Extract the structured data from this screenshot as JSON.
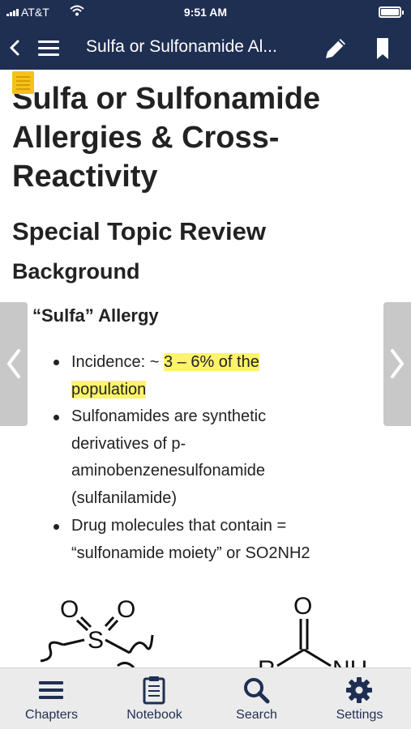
{
  "status_bar": {
    "carrier": "AT&T",
    "time": "9:51 AM"
  },
  "nav": {
    "title": "Sulfa or Sulfonamide Al..."
  },
  "article": {
    "title_lines": [
      "Sulfa or Sulfonamide",
      "Allergies & Cross-",
      "Reactivity"
    ],
    "subtitle": "Special Topic Review",
    "section": "Background",
    "bullet": "“Sulfa” Allergy",
    "sub_bullets": [
      {
        "lines": [
          "Incidence: ~ ",
          "3 – 6% of the",
          "population"
        ]
      },
      {
        "lines": [
          "Sulfonamides are synthetic",
          "derivatives of p-",
          "aminobenzenesulfonamide",
          "(sulfanilamide)"
        ]
      },
      {
        "lines": [
          "Drug molecules that contain =",
          "“sulfonamide moiety” or SO2NH2"
        ]
      }
    ]
  },
  "molecules": {
    "sulfonyl": {
      "o1": "O",
      "o2": "O",
      "s": "S"
    },
    "amide": {
      "o": "O",
      "r": "R",
      "nh": "NH"
    }
  },
  "tabs": [
    {
      "label": "Chapters",
      "icon": "list-icon"
    },
    {
      "label": "Notebook",
      "icon": "clipboard-icon"
    },
    {
      "label": "Search",
      "icon": "search-icon"
    },
    {
      "label": "Settings",
      "icon": "gear-icon"
    }
  ],
  "colors": {
    "nav_bg": "#1f2f52",
    "highlight": "#fdf36c",
    "note_tab": "#f5c21a",
    "tabbar_bg": "#ebebeb"
  }
}
